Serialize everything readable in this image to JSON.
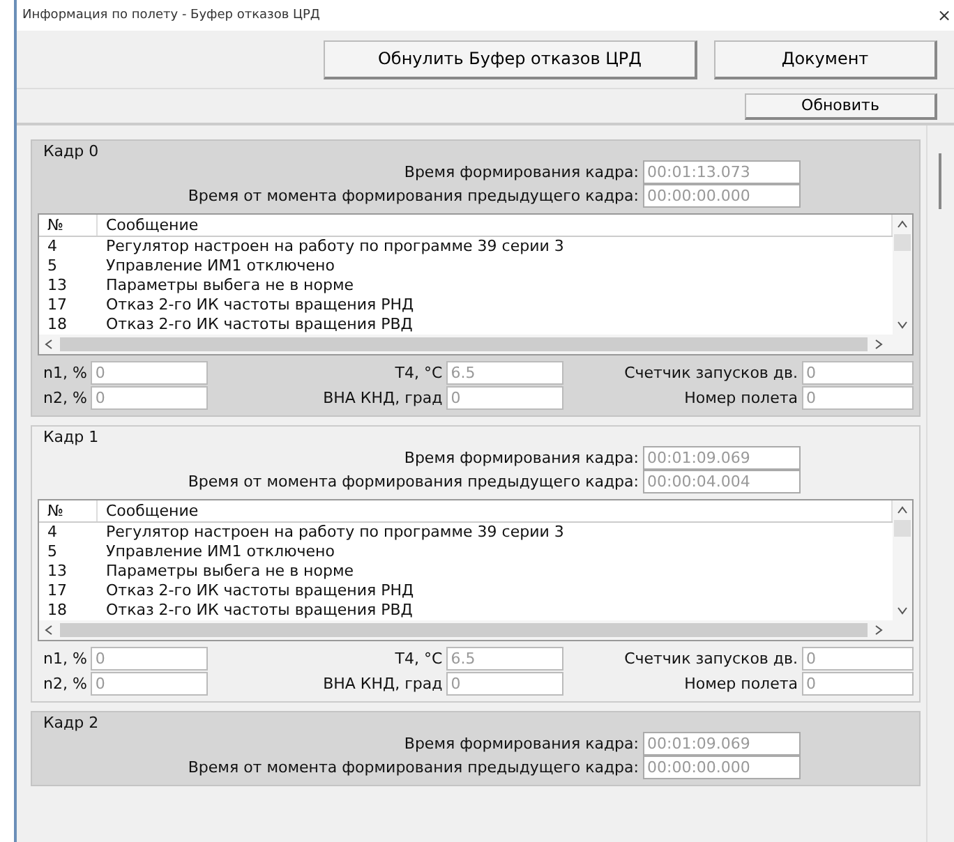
{
  "window": {
    "title": "Информация по полету - Буфер отказов ЦРД",
    "close": "×"
  },
  "toolbar": {
    "buttons": [
      "Обнулить Буфер отказов ЦРД",
      "Документ"
    ],
    "refresh": "Обновить"
  },
  "frames": [
    {
      "legend": "Кадр 0",
      "highlighted": true,
      "time_label": "Время формирования кадра:",
      "time": "00:01:13.073",
      "delta_label": "Время от момента формирования предыдущего кадра:",
      "delta": "00:00:00.000",
      "columns": [
        "№",
        "Сообщение"
      ],
      "messages": [
        {
          "no": "4",
          "text": "Регулятор настроен на работу по программе 39 серии 3"
        },
        {
          "no": "5",
          "text": "Управление ИМ1 отключено"
        },
        {
          "no": "13",
          "text": "Параметры выбега не в норме"
        },
        {
          "no": "17",
          "text": "Отказ 2-го  ИК частоты вращения РНД"
        },
        {
          "no": "18",
          "text": "Отказ 2-го ИК частоты вращения РВД"
        }
      ],
      "fields": [
        {
          "label": "n1, %",
          "value": "0"
        },
        {
          "label": "T4, °C",
          "value": "6.5"
        },
        {
          "label": "Счетчик запусков дв.",
          "value": "0"
        },
        {
          "label": "n2, %",
          "value": "0"
        },
        {
          "label": "ВНА КНД, град",
          "value": "0"
        },
        {
          "label": "Номер полета",
          "value": "0"
        }
      ]
    },
    {
      "legend": "Кадр 1",
      "highlighted": false,
      "time_label": "Время формирования кадра:",
      "time": "00:01:09.069",
      "delta_label": "Время от момента формирования предыдущего кадра:",
      "delta": "00:00:04.004",
      "columns": [
        "№",
        "Сообщение"
      ],
      "messages": [
        {
          "no": "4",
          "text": "Регулятор настроен на работу по программе 39 серии 3"
        },
        {
          "no": "5",
          "text": "Управление ИМ1 отключено"
        },
        {
          "no": "13",
          "text": "Параметры выбега не в норме"
        },
        {
          "no": "17",
          "text": "Отказ 2-го  ИК частоты вращения РНД"
        },
        {
          "no": "18",
          "text": "Отказ 2-го ИК частоты вращения РВД"
        }
      ],
      "fields": [
        {
          "label": "n1, %",
          "value": "0"
        },
        {
          "label": "T4, °C",
          "value": "6.5"
        },
        {
          "label": "Счетчик запусков дв.",
          "value": "0"
        },
        {
          "label": "n2, %",
          "value": "0"
        },
        {
          "label": "ВНА КНД, град",
          "value": "0"
        },
        {
          "label": "Номер полета",
          "value": "0"
        }
      ]
    },
    {
      "legend": "Кадр 2",
      "highlighted": true,
      "time_label": "Время формирования кадра:",
      "time": "00:01:09.069",
      "delta_label": "Время от момента формирования предыдущего кадра:",
      "delta": "00:00:00.000"
    }
  ]
}
